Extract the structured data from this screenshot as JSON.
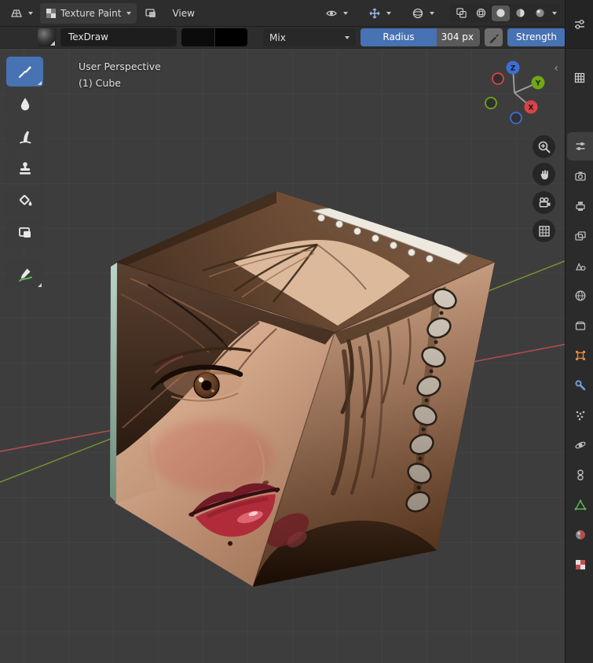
{
  "header": {
    "mode_label": "Texture Paint",
    "menu_view": "View"
  },
  "tool_settings": {
    "brush_name": "TexDraw",
    "primary_color": "#0b0b0b",
    "secondary_color": "#000000",
    "blend_mode": "Mix",
    "radius_label": "Radius",
    "radius_value": "304 px",
    "strength_label": "Strength"
  },
  "toolbar": {
    "tools": [
      "draw",
      "soften",
      "smear",
      "clone",
      "fill",
      "mask",
      "annotate"
    ],
    "active_tool": "draw"
  },
  "viewport": {
    "perspective_label": "User Perspective",
    "object_label": "(1) Cube",
    "axis_x": "X",
    "axis_y": "Y",
    "axis_z": "Z",
    "nav_buttons": [
      "zoom",
      "pan",
      "camera",
      "orthographic"
    ]
  },
  "properties": {
    "tabs": [
      "tool",
      "render",
      "output",
      "view-layer",
      "scene",
      "world",
      "collection",
      "object",
      "modifiers",
      "particles",
      "physics",
      "constraints",
      "object-data",
      "material",
      "texture"
    ],
    "active_tab": "tool"
  },
  "colors": {
    "accent": "#4772b3",
    "axis_x": "#c94f4f",
    "axis_y": "#7da32e",
    "gizmo_x": "#d8434b",
    "gizmo_y": "#71a614",
    "gizmo_z": "#3d6fd2",
    "viewport_bg": "#3d3d3d"
  }
}
